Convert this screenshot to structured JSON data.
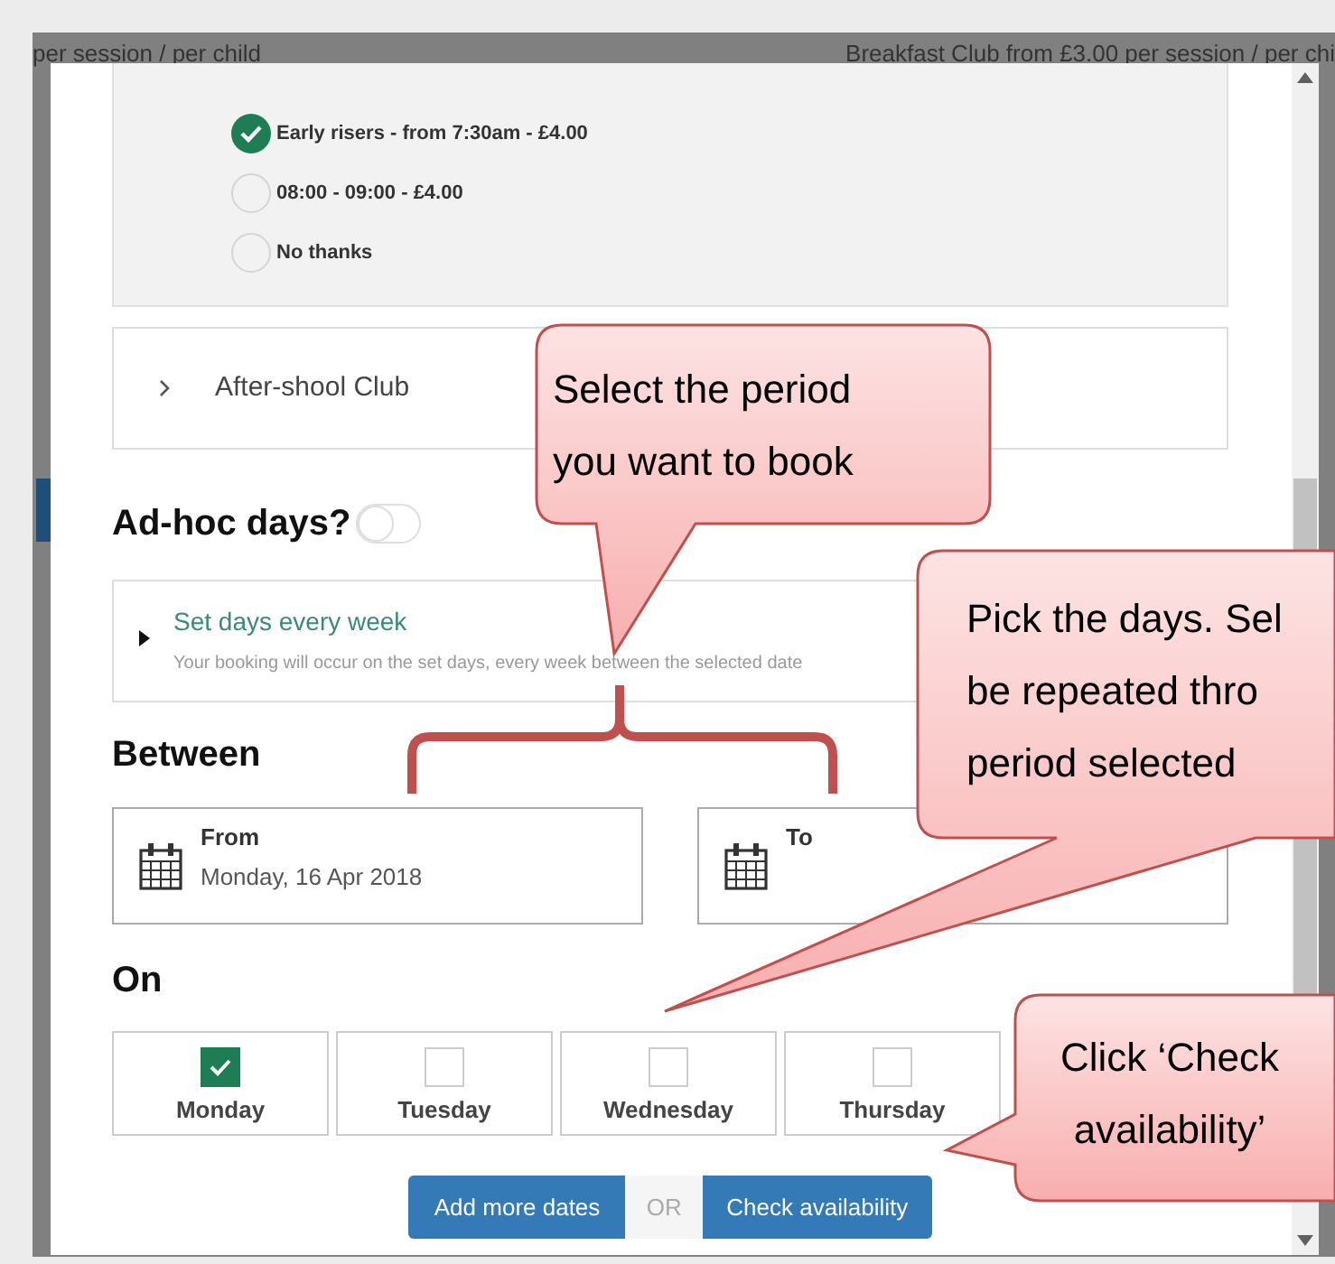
{
  "background": {
    "texts": [
      "per session / per child",
      "Breakfast Club from £3.00 per session / per chi"
    ]
  },
  "modal": {
    "options": [
      {
        "label": "Early risers - from 7:30am - £4.00",
        "selected": true
      },
      {
        "label": "08:00 - 09:00 - £4.00",
        "selected": false
      },
      {
        "label": "No thanks",
        "selected": false
      }
    ],
    "club": {
      "label": "After-shool Club",
      "expanded": false
    },
    "adhoc": {
      "label": "Ad-hoc days?",
      "on": false
    },
    "set_days": {
      "title": "Set days every week",
      "description": "Your booking will occur on the set days, every week between the selected date",
      "expanded": false
    },
    "between": {
      "heading": "Between",
      "from": {
        "label": "From",
        "value": "Monday, 16 Apr 2018"
      },
      "to": {
        "label": "To"
      }
    },
    "on": {
      "heading": "On",
      "days": [
        {
          "label": "Monday",
          "checked": true
        },
        {
          "label": "Tuesday",
          "checked": false
        },
        {
          "label": "Wednesday",
          "checked": false
        },
        {
          "label": "Thursday",
          "checked": false
        }
      ]
    },
    "buttons": {
      "add": "Add more dates",
      "or": "OR",
      "check": "Check availability"
    }
  },
  "callouts": [
    {
      "lines": [
        "Select the period",
        "you want to book"
      ]
    },
    {
      "lines": [
        "Pick the days. Sel",
        "be repeated thro",
        "period selected"
      ]
    },
    {
      "lines": [
        "Click ‘Check",
        "availability’"
      ]
    }
  ]
}
